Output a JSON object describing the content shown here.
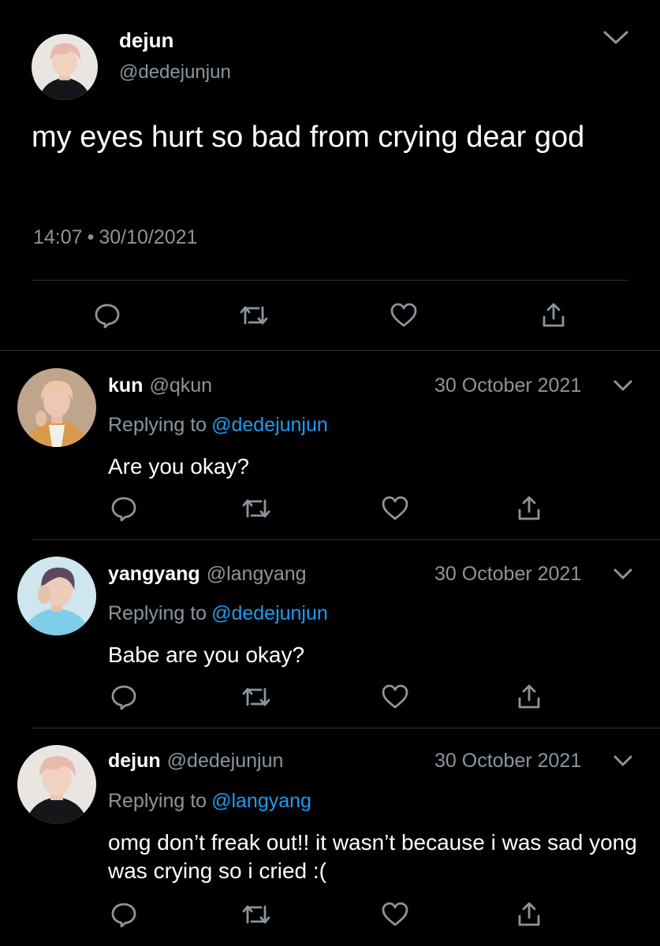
{
  "main_tweet": {
    "author_name": "dejun",
    "author_handle": "@dedejunjun",
    "text": "my eyes hurt so bad from crying dear god",
    "time": "14:07",
    "separator": "•",
    "date": "30/10/2021"
  },
  "replies": [
    {
      "name": "kun",
      "handle": "@qkun",
      "date": "30 October 2021",
      "replying_prefix": "Replying to",
      "replying_to": "@dedejunjun",
      "text": "Are you okay?"
    },
    {
      "name": "yangyang",
      "handle": "@langyang",
      "date": "30 October 2021",
      "replying_prefix": "Replying to",
      "replying_to": "@dedejunjun",
      "text": "Babe are you okay?"
    },
    {
      "name": "dejun",
      "handle": "@dedejunjun",
      "date": "30 October 2021",
      "replying_prefix": "Replying to",
      "replying_to": "@langyang",
      "text": "omg don’t freak out!! it wasn’t because i was sad yong was crying so i cried :("
    }
  ],
  "icons": {
    "reply": "reply-icon",
    "retweet": "retweet-icon",
    "like": "heart-icon",
    "share": "share-icon",
    "menu": "chevron-down-icon"
  },
  "colors": {
    "background": "#000000",
    "text": "#ffffff",
    "secondary": "#8b959e",
    "link": "#1d9bf0",
    "divider": "#2f3336"
  }
}
